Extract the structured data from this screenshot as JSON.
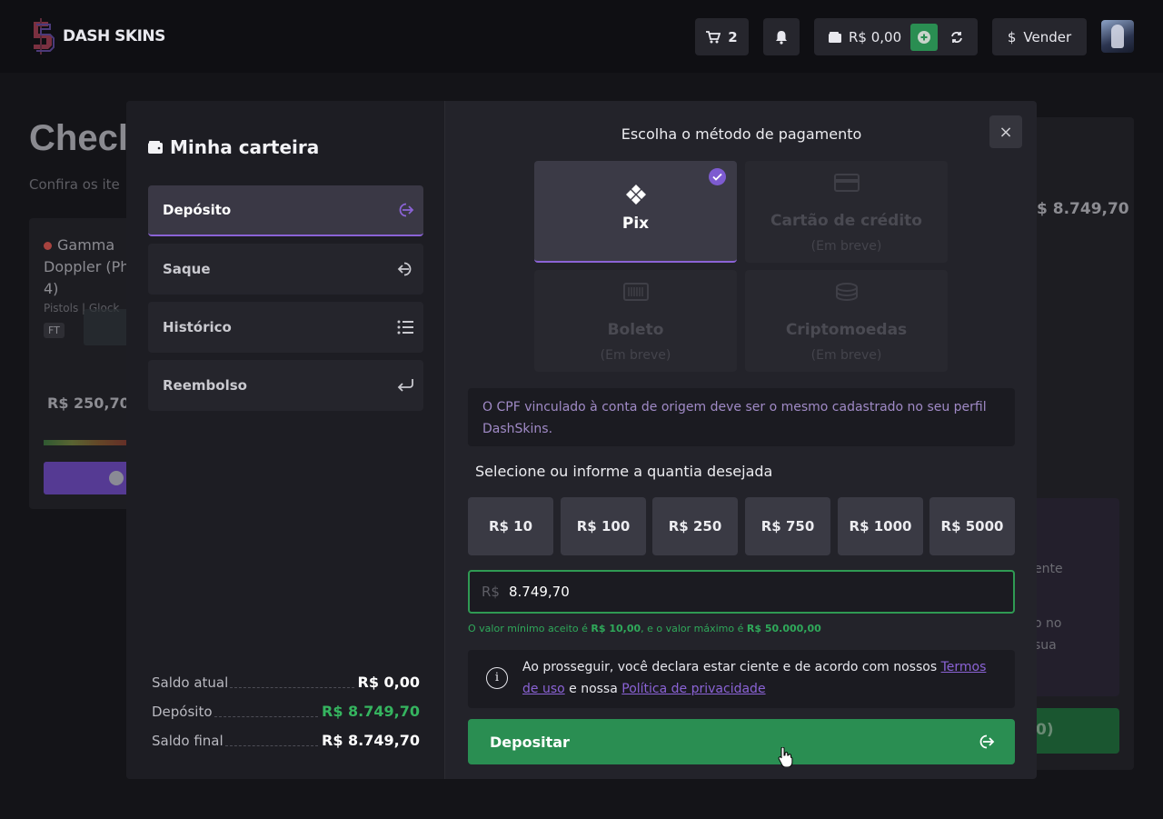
{
  "navbar": {
    "logo_text": "DASH SKINS",
    "cart_count": "2",
    "balance": "R$ 0,00",
    "sell_label": "Vender"
  },
  "background": {
    "title": "Checl",
    "subtitle": "Confira os ite",
    "item_name_1": "Gamma",
    "item_name_2": "Doppler (Ph",
    "item_name_3": "4)",
    "item_type": "Pistols | Glock",
    "item_wear": "FT",
    "item_price": "R$ 250,70",
    "total": "$ 8.749,70",
    "side_text_1": "ente",
    "side_text_2": "o no",
    "side_text_3": "sua",
    "side_btn": "0)"
  },
  "wallet": {
    "title": "Minha carteira",
    "menu": [
      {
        "label": "Depósito"
      },
      {
        "label": "Saque"
      },
      {
        "label": "Histórico"
      },
      {
        "label": "Reembolso"
      }
    ],
    "summary": {
      "current_label": "Saldo atual",
      "current_value": "R$ 0,00",
      "deposit_label": "Depósito",
      "deposit_value": "R$ 8.749,70",
      "final_label": "Saldo final",
      "final_value": "R$ 8.749,70"
    }
  },
  "payment": {
    "title": "Escolha o método de pagamento",
    "close_label": "×",
    "methods": [
      {
        "name": "Pix",
        "status": ""
      },
      {
        "name": "Cartão de crédito",
        "status": "(Em breve)"
      },
      {
        "name": "Boleto",
        "status": "(Em breve)"
      },
      {
        "name": "Criptomoedas",
        "status": "(Em breve)"
      }
    ],
    "notice": "O CPF vinculado à conta de origem deve ser o mesmo cadastrado no seu perfil DashSkins.",
    "select_label": "Selecione ou informe a quantia desejada",
    "amounts": [
      "R$ 10",
      "R$ 100",
      "R$ 250",
      "R$ 750",
      "R$ 1000",
      "R$ 5000"
    ],
    "currency_prefix": "R$",
    "amount_value": "8.749,70",
    "minmax_pre": "O valor mínimo aceito é ",
    "min_value": "R$ 10,00",
    "minmax_mid": ", e o valor máximo é ",
    "max_value": "R$ 50.000,00",
    "terms_pre": "Ao prosseguir, você declara estar ciente e de acordo com nossos ",
    "terms_link": "Termos de uso",
    "terms_mid": " e nossa ",
    "privacy_link": "Política de privacidade",
    "deposit_button": "Depositar"
  },
  "colors": {
    "accent_purple": "#8b63d6",
    "success_green": "#2a8e52",
    "modal_bg": "#23232a"
  }
}
